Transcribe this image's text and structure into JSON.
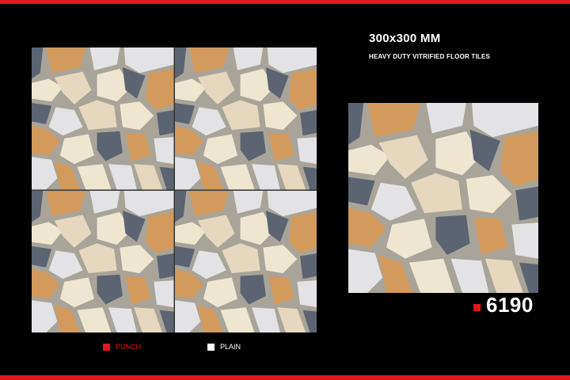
{
  "product": {
    "size": "300x300 MM",
    "description": "HEAVY DUTY VITRIFIED FLOOR TILES",
    "code": "6190"
  },
  "legend": {
    "punch_label": "PUNCH",
    "plain_label": "PLAIN"
  },
  "colors": {
    "accent": "#e0171e",
    "background": "#000000",
    "grout": "#a8a49a",
    "stone_orange": "#d39a5e",
    "stone_beige": "#e6d8be",
    "stone_cream": "#efe6d2",
    "stone_gray": "#e3e3e6",
    "stone_slate": "#5b6470"
  }
}
